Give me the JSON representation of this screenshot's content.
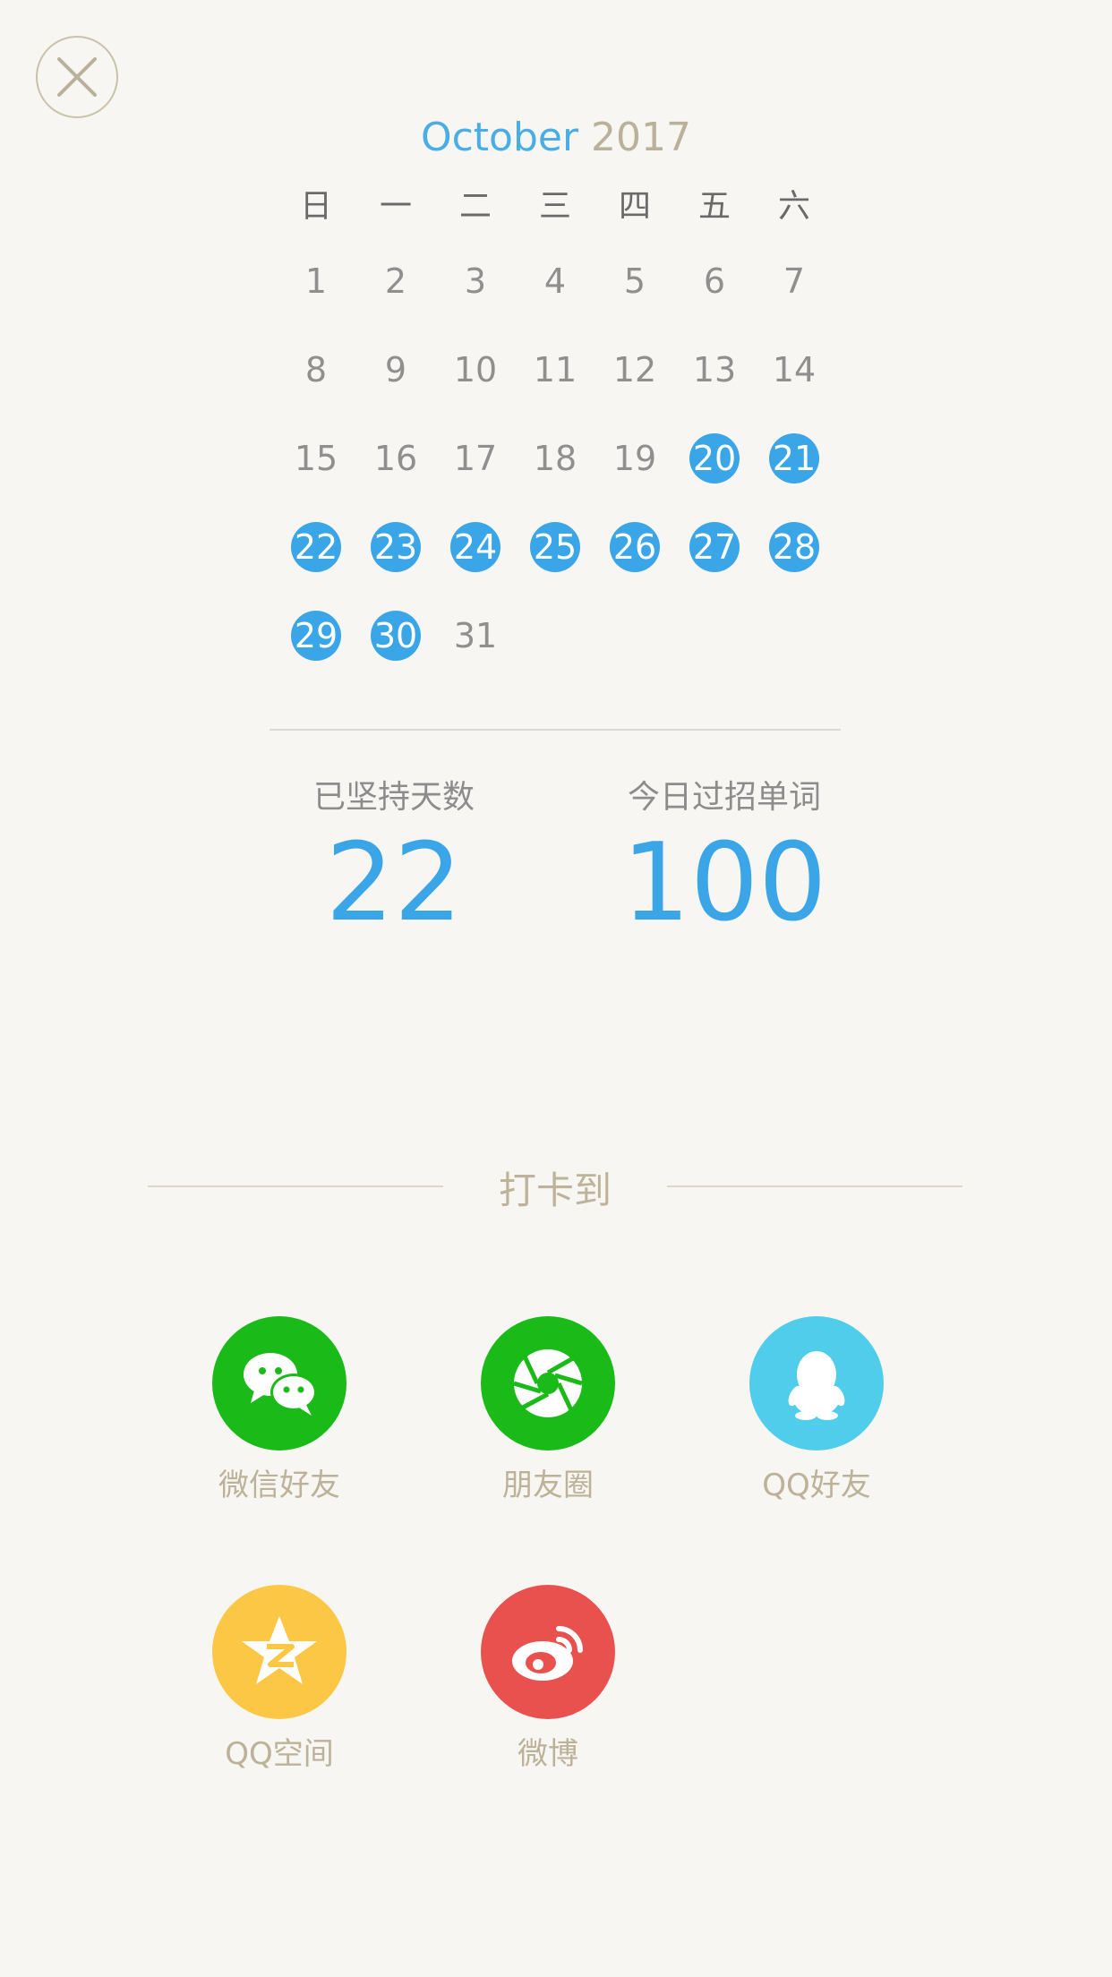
{
  "calendar": {
    "month": "October",
    "year": "2017",
    "weekdays": [
      "日",
      "一",
      "二",
      "三",
      "四",
      "五",
      "六"
    ],
    "weeks": [
      [
        {
          "d": "1"
        },
        {
          "d": "2"
        },
        {
          "d": "3"
        },
        {
          "d": "4"
        },
        {
          "d": "5"
        },
        {
          "d": "6"
        },
        {
          "d": "7"
        }
      ],
      [
        {
          "d": "8"
        },
        {
          "d": "9"
        },
        {
          "d": "10"
        },
        {
          "d": "11"
        },
        {
          "d": "12"
        },
        {
          "d": "13"
        },
        {
          "d": "14"
        }
      ],
      [
        {
          "d": "15"
        },
        {
          "d": "16"
        },
        {
          "d": "17"
        },
        {
          "d": "18"
        },
        {
          "d": "19"
        },
        {
          "d": "20",
          "marked": true
        },
        {
          "d": "21",
          "marked": true
        }
      ],
      [
        {
          "d": "22",
          "marked": true
        },
        {
          "d": "23",
          "marked": true
        },
        {
          "d": "24",
          "marked": true
        },
        {
          "d": "25",
          "marked": true
        },
        {
          "d": "26",
          "marked": true
        },
        {
          "d": "27",
          "marked": true
        },
        {
          "d": "28",
          "marked": true
        }
      ],
      [
        {
          "d": "29",
          "marked": true
        },
        {
          "d": "30",
          "marked": true
        },
        {
          "d": "31"
        },
        {
          "d": ""
        },
        {
          "d": ""
        },
        {
          "d": ""
        },
        {
          "d": ""
        }
      ]
    ],
    "marked_color": "#3aa6e8"
  },
  "stats": {
    "days_label": "已坚持天数",
    "days_value": "22",
    "words_label": "今日过招单词",
    "words_value": "100"
  },
  "share": {
    "title": "打卡到",
    "items": [
      {
        "label": "微信好友",
        "icon": "wechat-icon",
        "color": "#1aba18"
      },
      {
        "label": "朋友圈",
        "icon": "moments-icon",
        "color": "#1aba18"
      },
      {
        "label": "QQ好友",
        "icon": "qq-icon",
        "color": "#4fcdea"
      },
      {
        "label": "QQ空间",
        "icon": "qzone-icon",
        "color": "#fbc744"
      },
      {
        "label": "微博",
        "icon": "weibo-icon",
        "color": "#e9514f"
      }
    ]
  }
}
